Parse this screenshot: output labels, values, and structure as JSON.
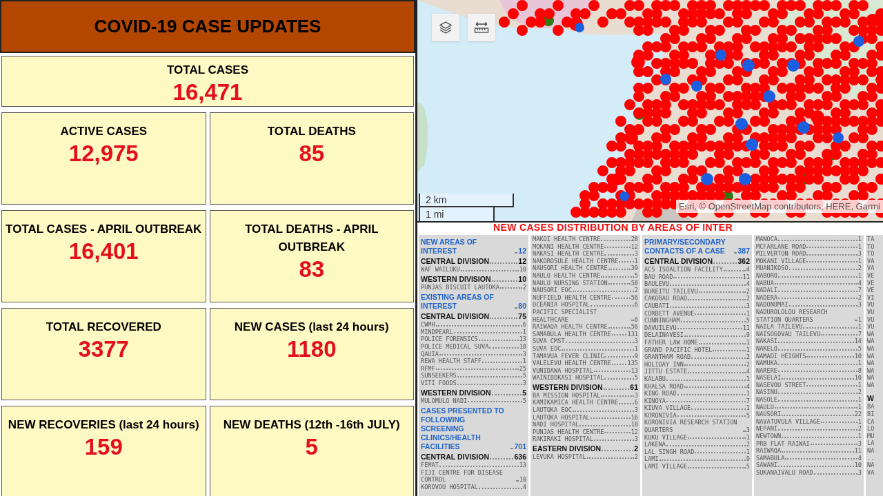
{
  "header": {
    "title": "COVID-19 CASE UPDATES"
  },
  "total_cases": {
    "label": "TOTAL CASES",
    "value": "16,471"
  },
  "stats": [
    {
      "label": "ACTIVE CASES",
      "value": "12,975"
    },
    {
      "label": "TOTAL DEATHS",
      "value": "85"
    },
    {
      "label": "TOTAL CASES - APRIL OUTBREAK",
      "value": "16,401"
    },
    {
      "label": "TOTAL DEATHS - APRIL OUTBREAK",
      "value": "83"
    },
    {
      "label": "TOTAL RECOVERED",
      "value": "3377"
    },
    {
      "label": "NEW CASES (last 24 hours)",
      "value": "1180"
    },
    {
      "label": "NEW RECOVERIES (last 24 hours)",
      "value": "159"
    },
    {
      "label": "NEW DEATHS (12th -16th JULY)",
      "value": "5"
    }
  ],
  "map": {
    "scale": [
      "2 km",
      "1 mi"
    ],
    "attribution": "Esri, © OpenStreetMap contributors, HERE, Garmi"
  },
  "distribution": {
    "title": "NEW CASES DISTRIBUTION BY AREAS OF INTER",
    "columns": [
      [
        {
          "kind": "section",
          "text": "NEW AREAS OF INTEREST",
          "count": "12"
        },
        {
          "kind": "division",
          "text": "CENTRAL DIVISION",
          "count": "12"
        },
        {
          "kind": "place",
          "text": "WAF WAILOKU",
          "count": "10"
        },
        {
          "kind": "division",
          "text": "WESTERN DIVISION",
          "count": "10"
        },
        {
          "kind": "place",
          "text": "PUNJAS BISCUIT LAUTOKA",
          "count": "2"
        },
        {
          "kind": "section",
          "text": "EXISTING AREAS OF INTEREST",
          "count": "80"
        },
        {
          "kind": "division",
          "text": "CENTRAL DIVISION",
          "count": "75"
        },
        {
          "kind": "place",
          "text": "CWMH",
          "count": "6"
        },
        {
          "kind": "place",
          "text": "MINDPEARL",
          "count": "1"
        },
        {
          "kind": "place",
          "text": "POLICE FORENSICS",
          "count": "13"
        },
        {
          "kind": "place",
          "text": "POLICE MEDICAL SUVA",
          "count": "18"
        },
        {
          "kind": "place",
          "text": "QAUIA",
          "count": "3"
        },
        {
          "kind": "place",
          "text": "REWA HEALTH STAFF",
          "count": "1"
        },
        {
          "kind": "place",
          "text": "RFMF",
          "count": "25"
        },
        {
          "kind": "place",
          "text": "SUNSEEKERS",
          "count": "5"
        },
        {
          "kind": "place",
          "text": "VITI FOODS",
          "count": "3"
        },
        {
          "kind": "division",
          "text": "WESTERN DIVISION",
          "count": "5"
        },
        {
          "kind": "place",
          "text": "MULOMULO NADI",
          "count": "5"
        },
        {
          "kind": "section",
          "text": "CASES PRESENTED TO FOLLOWING SCREENING CLINICS/HEALTH FACILITIES",
          "count": "701"
        },
        {
          "kind": "division",
          "text": "CENTRAL DIVISION",
          "count": "636"
        },
        {
          "kind": "place",
          "text": "FEMAT",
          "count": "13"
        },
        {
          "kind": "place",
          "text": "FIJI CENTRE FOR DISEASE CONTROL",
          "count": "10"
        },
        {
          "kind": "place",
          "text": "KOROVOU HOSPITAL",
          "count": "4"
        }
      ],
      [
        {
          "kind": "place",
          "text": "MAKOI HEALTH CENTRE",
          "count": "28"
        },
        {
          "kind": "place",
          "text": "MOKANI HEALTH CENTRE",
          "count": "12"
        },
        {
          "kind": "place",
          "text": "NAKASI HEALTH CENTRE",
          "count": "3"
        },
        {
          "kind": "place",
          "text": "NAKOROSULE HEALTH CENTRE",
          "count": "1"
        },
        {
          "kind": "place",
          "text": "NAUSORI HEALTH CENTRE",
          "count": "39"
        },
        {
          "kind": "place",
          "text": "NAULU HEALTH CENTRE",
          "count": "5"
        },
        {
          "kind": "place",
          "text": "NAULU NURSING STATION",
          "count": "58"
        },
        {
          "kind": "place",
          "text": "NAUSORI EOC",
          "count": "2"
        },
        {
          "kind": "place",
          "text": "NUFFIELD HEALTH CENTRE",
          "count": "56"
        },
        {
          "kind": "place",
          "text": "OCEANIA HOSPITAL",
          "count": "6"
        },
        {
          "kind": "place",
          "text": "PACIFIC SPECIALIST HEALTHCARE",
          "count": "6"
        },
        {
          "kind": "place",
          "text": "RAIWAQA HEALTH CENTRE",
          "count": "56"
        },
        {
          "kind": "place",
          "text": "SAMABULA HEALTH CENTRE",
          "count": "131"
        },
        {
          "kind": "place",
          "text": "SUVA CMST",
          "count": "3"
        },
        {
          "kind": "place",
          "text": "SUVA EOC",
          "count": "1"
        },
        {
          "kind": "place",
          "text": "TAMAVUA FEVER CLINIC",
          "count": "9"
        },
        {
          "kind": "place",
          "text": "VALELEVU HEALTH CENTRE",
          "count": "135"
        },
        {
          "kind": "place",
          "text": "VUNIDAWA HOSPITAL",
          "count": "13"
        },
        {
          "kind": "place",
          "text": "WAINIBOKASI HOSPITAL",
          "count": "5"
        },
        {
          "kind": "division",
          "text": "WESTERN DIVISION",
          "count": "61"
        },
        {
          "kind": "place",
          "text": "BA MISSION HOSPITAL",
          "count": "3"
        },
        {
          "kind": "place",
          "text": "KAMIKAMICA HEALTH CENTRE",
          "count": "6"
        },
        {
          "kind": "place",
          "text": "LAUTOKA EOC",
          "count": "3"
        },
        {
          "kind": "place",
          "text": "LAUTOKA HOSPITAL",
          "count": "16"
        },
        {
          "kind": "place",
          "text": "NADI HOSPITAL",
          "count": "18"
        },
        {
          "kind": "place",
          "text": "PUNJAS HEALTH CENTRE",
          "count": "12"
        },
        {
          "kind": "place",
          "text": "RAKIRAKI HOSPITAL",
          "count": "3"
        },
        {
          "kind": "division",
          "text": "EASTERN DIVISION",
          "count": "2"
        },
        {
          "kind": "place",
          "text": "LEVUKA HOSPITAL",
          "count": "2"
        }
      ],
      [
        {
          "kind": "section",
          "text": "PRIMARY/SECONDARY CONTACTS OF A CASE",
          "count": "387"
        },
        {
          "kind": "division",
          "text": "CENTRAL DIVISION",
          "count": "362"
        },
        {
          "kind": "place",
          "text": "ACS ISOALTION FACILITY",
          "count": "4"
        },
        {
          "kind": "place",
          "text": "BAU ROAD",
          "count": "11"
        },
        {
          "kind": "place",
          "text": "BAULEVU",
          "count": "4"
        },
        {
          "kind": "place",
          "text": "BUREITU TAILEVU",
          "count": "2"
        },
        {
          "kind": "place",
          "text": "CAKOBAU ROAD",
          "count": "2"
        },
        {
          "kind": "place",
          "text": "CAUBATI",
          "count": "3"
        },
        {
          "kind": "place",
          "text": "CORBETT AVENUE",
          "count": "1"
        },
        {
          "kind": "place",
          "text": "CUNNINGHAM",
          "count": "5"
        },
        {
          "kind": "place",
          "text": "DAVUILEVU",
          "count": "11"
        },
        {
          "kind": "place",
          "text": "DELAINAVESI",
          "count": "9"
        },
        {
          "kind": "place",
          "text": "FATHER LAW HOME",
          "count": "1"
        },
        {
          "kind": "place",
          "text": "GRAND PACIFIC HOTEL",
          "count": "1"
        },
        {
          "kind": "place",
          "text": "GRANTHAM ROAD",
          "count": "2"
        },
        {
          "kind": "place",
          "text": "HOLIDAY INN",
          "count": "2"
        },
        {
          "kind": "place",
          "text": "JITTU ESTATE",
          "count": "4"
        },
        {
          "kind": "place",
          "text": "KALABU",
          "count": "1"
        },
        {
          "kind": "place",
          "text": "KHALSA ROAD",
          "count": "4"
        },
        {
          "kind": "place",
          "text": "KING ROAD",
          "count": "1"
        },
        {
          "kind": "place",
          "text": "KINOYA",
          "count": "7"
        },
        {
          "kind": "place",
          "text": "KIUVA VILLAGE",
          "count": "1"
        },
        {
          "kind": "place",
          "text": "KORONIVIA",
          "count": "5"
        },
        {
          "kind": "place",
          "text": "KORONIVIA RESEARCH STATION QUARTERS",
          "count": "3"
        },
        {
          "kind": "place",
          "text": "KUKU VILLAGE",
          "count": "1"
        },
        {
          "kind": "place",
          "text": "LAKENA",
          "count": "2"
        },
        {
          "kind": "place",
          "text": "LAL SINGH ROAD",
          "count": "1"
        },
        {
          "kind": "place",
          "text": "LAMI",
          "count": "9"
        },
        {
          "kind": "place",
          "text": "LAMI VILLAGE",
          "count": "5"
        }
      ],
      [
        {
          "kind": "place",
          "text": "MANOCA",
          "count": "1"
        },
        {
          "kind": "place",
          "text": "MCFARLANE ROAD",
          "count": "1"
        },
        {
          "kind": "place",
          "text": "MILVERTON ROAD",
          "count": "3"
        },
        {
          "kind": "place",
          "text": "MOKANI VILLAGE",
          "count": "1"
        },
        {
          "kind": "place",
          "text": "MUANIKOSO",
          "count": "2"
        },
        {
          "kind": "place",
          "text": "NABORO",
          "count": "1"
        },
        {
          "kind": "place",
          "text": "NABUA",
          "count": "4"
        },
        {
          "kind": "place",
          "text": "NADALI",
          "count": "7"
        },
        {
          "kind": "place",
          "text": "NADERA",
          "count": "2"
        },
        {
          "kind": "place",
          "text": "NADONUMAI",
          "count": "3"
        },
        {
          "kind": "place",
          "text": "NADUROLOLOU RESEARCH STATION QUARTERS",
          "count": "1"
        },
        {
          "kind": "place",
          "text": "NAILA TAILEVU",
          "count": "1"
        },
        {
          "kind": "place",
          "text": "NAISOGOVAU TAILEVU",
          "count": "7"
        },
        {
          "kind": "place",
          "text": "NAKASI",
          "count": "14"
        },
        {
          "kind": "place",
          "text": "NAKELO",
          "count": "5"
        },
        {
          "kind": "place",
          "text": "NAMADI HEIGHTS",
          "count": "10"
        },
        {
          "kind": "place",
          "text": "NAMUKA",
          "count": "1"
        },
        {
          "kind": "place",
          "text": "NARERE",
          "count": "8"
        },
        {
          "kind": "place",
          "text": "NASELAI",
          "count": "10"
        },
        {
          "kind": "place",
          "text": "NASEVOU STREET",
          "count": "1"
        },
        {
          "kind": "place",
          "text": "NASINU",
          "count": "2"
        },
        {
          "kind": "place",
          "text": "NASOLE",
          "count": "1"
        },
        {
          "kind": "place",
          "text": "NAULU",
          "count": "1"
        },
        {
          "kind": "place",
          "text": "NAUSORI",
          "count": "22"
        },
        {
          "kind": "place",
          "text": "NAVATUVULA VILLAGE",
          "count": "1"
        },
        {
          "kind": "place",
          "text": "NEPANI",
          "count": "2"
        },
        {
          "kind": "place",
          "text": "NEWTOWN",
          "count": "1"
        },
        {
          "kind": "place",
          "text": "PRB FLAT RAIWAI",
          "count": "3"
        },
        {
          "kind": "place",
          "text": "RAIWAQA",
          "count": "11"
        },
        {
          "kind": "place",
          "text": "SAMABULA",
          "count": "4"
        },
        {
          "kind": "place",
          "text": "SAWANI",
          "count": "10"
        },
        {
          "kind": "place",
          "text": "SUKANAIVALU ROAD",
          "count": "3"
        }
      ]
    ],
    "cut_column": [
      {
        "kind": "place",
        "text": "TA"
      },
      {
        "kind": "place",
        "text": "TO"
      },
      {
        "kind": "place",
        "text": "TO"
      },
      {
        "kind": "place",
        "text": "VA"
      },
      {
        "kind": "place",
        "text": "VA"
      },
      {
        "kind": "place",
        "text": "VE"
      },
      {
        "kind": "place",
        "text": "VE"
      },
      {
        "kind": "place",
        "text": "VE"
      },
      {
        "kind": "place",
        "text": "VI"
      },
      {
        "kind": "place",
        "text": "VU"
      },
      {
        "kind": "place",
        "text": "VU"
      },
      {
        "kind": "place",
        "text": "VU"
      },
      {
        "kind": "place",
        "text": "VU"
      },
      {
        "kind": "place",
        "text": "WA"
      },
      {
        "kind": "place",
        "text": "WA"
      },
      {
        "kind": "place",
        "text": "WA"
      },
      {
        "kind": "place",
        "text": "WA"
      },
      {
        "kind": "place",
        "text": "WA"
      },
      {
        "kind": "place",
        "text": "WA"
      },
      {
        "kind": "place",
        "text": "WA"
      },
      {
        "kind": "place",
        "text": "WA"
      },
      {
        "kind": "division",
        "text": "W"
      },
      {
        "kind": "place",
        "text": "BA"
      },
      {
        "kind": "place",
        "text": "BI"
      },
      {
        "kind": "place",
        "text": "CA"
      },
      {
        "kind": "place",
        "text": "LO"
      },
      {
        "kind": "place",
        "text": "MU"
      },
      {
        "kind": "place",
        "text": "LA"
      },
      {
        "kind": "place",
        "text": "NA"
      },
      {
        "kind": "place",
        "text": ".."
      },
      {
        "kind": "place",
        "text": "NA"
      },
      {
        "kind": "place",
        "text": "VA"
      }
    ]
  }
}
